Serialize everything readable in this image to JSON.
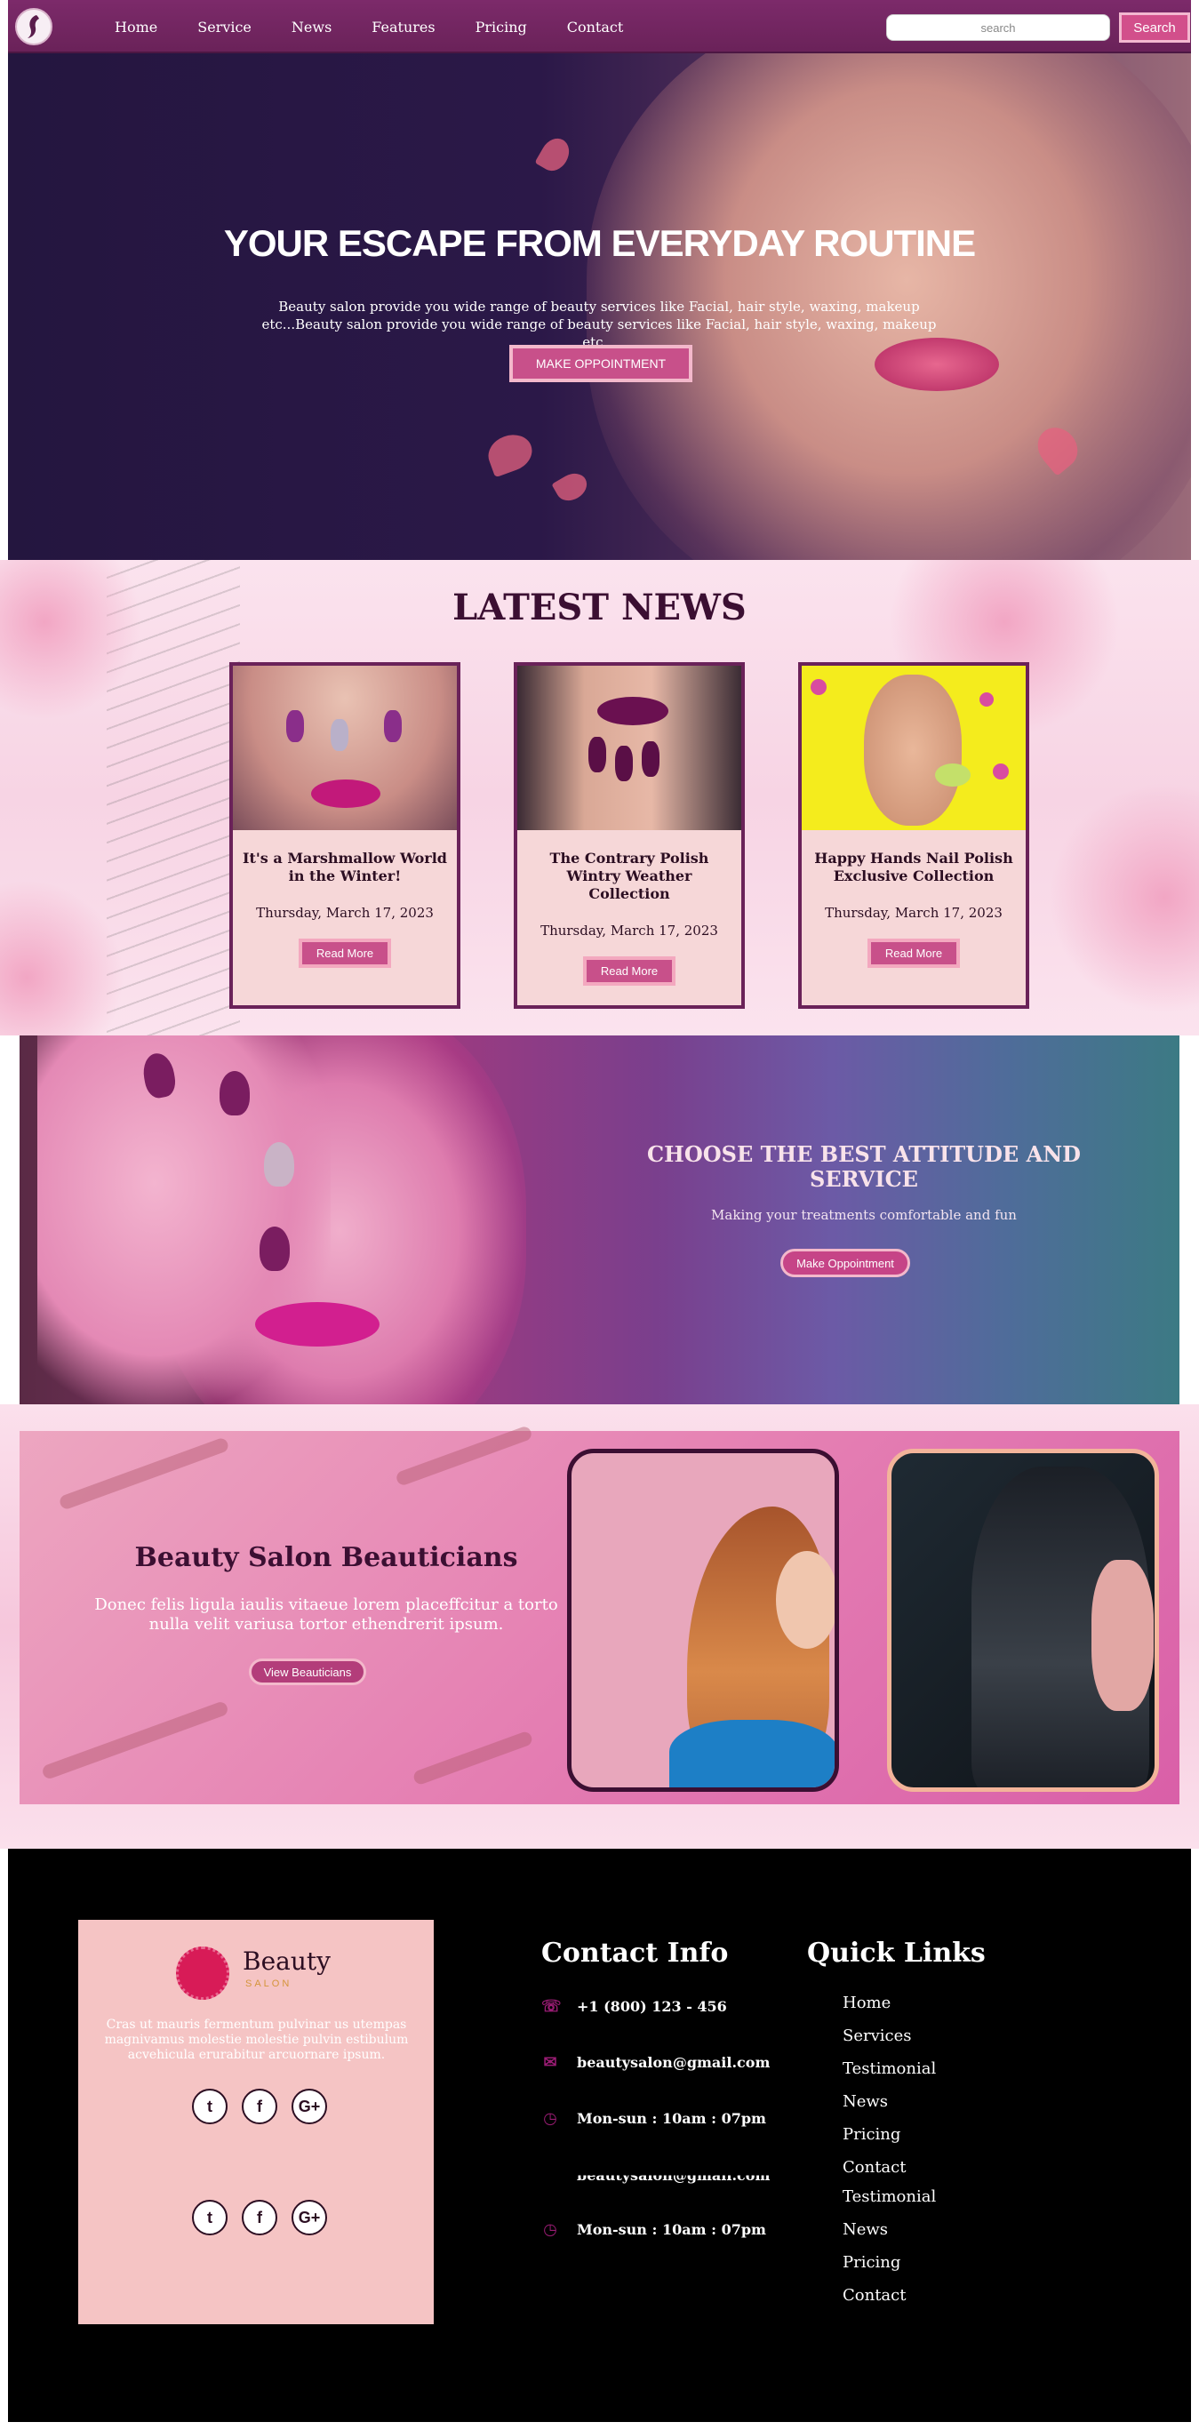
{
  "nav": {
    "items": [
      "Home",
      "Service",
      "News",
      "Features",
      "Pricing",
      "Contact"
    ],
    "search_placeholder": "search",
    "search_button": "Search"
  },
  "hero": {
    "title": "YOUR ESCAPE FROM EVERYDAY ROUTINE",
    "text": "Beauty salon provide you wide range of beauty services like Facial, hair style, waxing, makeup etc...Beauty salon provide you wide range of beauty services like Facial, hair style, waxing, makeup etc...",
    "button": "MAKE OPPOINTMENT"
  },
  "news": {
    "heading": "LATEST NEWS",
    "cards": [
      {
        "title": "It's a Marshmallow World in the Winter!",
        "date": "Thursday, March 17, 2023",
        "button": "Read More"
      },
      {
        "title": "The Contrary Polish Wintry Weather Collection",
        "date": "Thursday, March 17, 2023",
        "button": "Read More"
      },
      {
        "title": "Happy Hands Nail Polish Exclusive Collection",
        "date": "Thursday, March 17, 2023",
        "button": "Read More"
      }
    ]
  },
  "attitude": {
    "title": "CHOOSE THE BEST ATTITUDE AND SERVICE",
    "subtitle": "Making your treatments comfortable and fun",
    "button": "Make Oppointment"
  },
  "beauticians": {
    "title": "Beauty Salon Beauticians",
    "text": "Donec felis ligula iaulis vitaeue lorem placeffcitur a torto nulla velit variusa tortor ethendrerit ipsum.",
    "button": "View Beauticians"
  },
  "footer": {
    "brand": "Beauty",
    "brand_sub": "SALON",
    "about": "Cras ut mauris fermentum pulvinar us utempas magnivamus molestie molestie pulvin estibulum acvehicula erurabitur arcuornare ipsum.",
    "social_icons": [
      "twitter-icon",
      "facebook-icon",
      "google-plus-icon"
    ],
    "contact_title": "Contact Info",
    "contact": [
      {
        "icon": "phone-icon",
        "text": "+1 (800) 123 - 456"
      },
      {
        "icon": "mail-icon",
        "text": "beautysalon@gmail.com"
      },
      {
        "icon": "clock-icon",
        "text": "Mon-sun : 10am : 07pm"
      }
    ],
    "contact_dup": {
      "icon": "clock-icon",
      "text": "Mon-sun : 10am : 07pm",
      "overlap_text": "beautysalon@gmail.com"
    },
    "links_title": "Quick Links",
    "links": [
      "Home",
      "Services",
      "Testimonial",
      "News",
      "Pricing",
      "Contact"
    ],
    "links_dup": [
      "Testimonial",
      "News",
      "Pricing",
      "Contact"
    ]
  },
  "colors": {
    "brand": "#6a2259",
    "accent": "#c8508a",
    "card_bg": "#f6d7d8"
  }
}
